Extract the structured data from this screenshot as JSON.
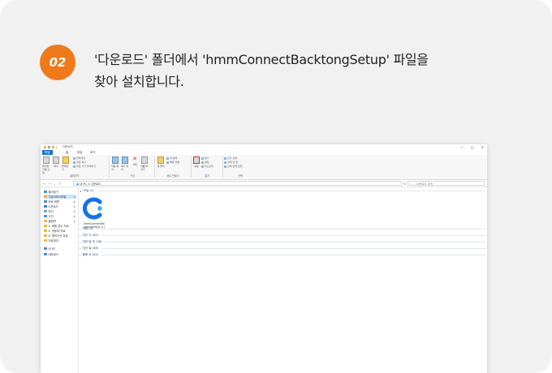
{
  "step": {
    "number": "02",
    "line1": "'다운로드' 폴더에서 'hmmConnectBacktongSetup' 파일을",
    "line2": "찾아 설치합니다.",
    "badge_color": "#f07a1a"
  },
  "explorer": {
    "title": "다운로드",
    "window_controls": [
      "—",
      "□",
      "✕"
    ],
    "tabs": [
      "파일",
      "홈",
      "공유",
      "보기"
    ],
    "ribbon": {
      "clipboard": {
        "label": "클립보드",
        "pin": "즐겨찾기에 고정",
        "copy": "복사",
        "paste": "붙여넣기",
        "cut": "잘라내기",
        "copy_path": "경로 복사",
        "paste_shortcut": "바로 가기 붙여넣기"
      },
      "organize": {
        "label": "구성",
        "move_to": "이동 위치",
        "copy_to": "복사 위치",
        "delete": "삭제",
        "rename": "이름 바꾸기"
      },
      "new": {
        "label": "새로 만들기",
        "new_folder": "새 폴더",
        "new_item": "새 항목",
        "easy_access": "빠른 연결"
      },
      "open": {
        "label": "열기",
        "properties": "속성",
        "open": "열기",
        "edit": "편집",
        "history": "히스토리"
      },
      "select": {
        "label": "선택",
        "select_all": "모두 선택",
        "select_none": "선택 안 함",
        "invert": "선택 영역 반전"
      }
    },
    "address": {
      "path": "내 PC > 다운로드",
      "search_placeholder": "다운로드 검색"
    },
    "nav": [
      {
        "label": "즐겨찾기",
        "color": "#4a8fd9"
      },
      {
        "label": "기본서비스파일",
        "color": "#e8b84a"
      },
      {
        "label": "바탕 화면",
        "color": "#4a8fd9"
      },
      {
        "label": "다운로드",
        "color": "#3a7bd5"
      },
      {
        "label": "문서",
        "color": "#8aa0b8"
      },
      {
        "label": "사진",
        "color": "#3c99d8"
      },
      {
        "label": "홈화면",
        "color": "#e8b84a"
      },
      {
        "label": "2. 회원 업무 자료",
        "color": "#e8b84a"
      },
      {
        "label": "4. 공동체 자료",
        "color": "#e8b84a"
      },
      {
        "label": "6. 협력기관 자료",
        "color": "#e8b84a"
      },
      {
        "label": "자료정리",
        "color": "#e8b84a"
      },
      {
        "label": "내 PC",
        "color": "#4a8fd9"
      },
      {
        "label": "네트워크",
        "color": "#4a8fd9"
      }
    ],
    "groups": [
      {
        "label": "오늘 (1)"
      },
      {
        "label": "어제 (2)"
      },
      {
        "label": "지난 주 (30)"
      },
      {
        "label": "이전 달 초 (28)"
      },
      {
        "label": "지난 달 (46)"
      },
      {
        "label": "올해 초 (42)"
      }
    ],
    "file": {
      "name_line1": "hmmConnectBa",
      "name_line2": "cktongSetup (1)",
      "icon": "hmm-connect-logo"
    }
  }
}
